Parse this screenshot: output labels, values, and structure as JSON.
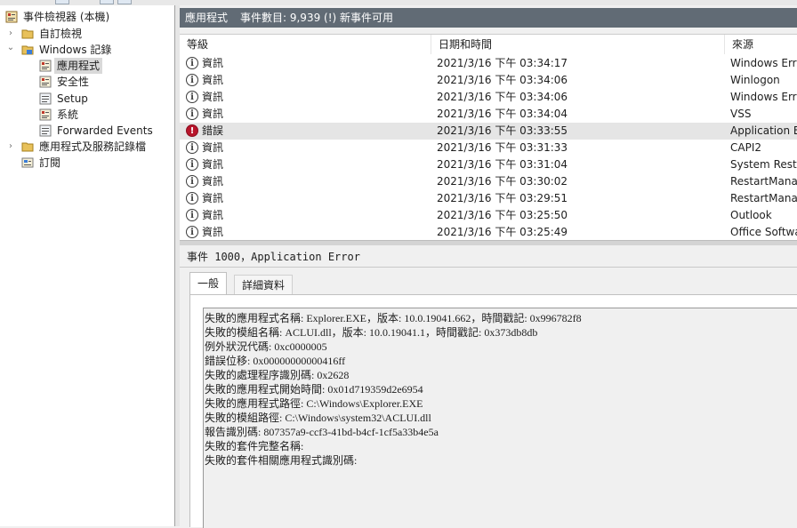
{
  "tree": {
    "items": [
      {
        "label": "事件檢視器 (本機)",
        "icon": "event-viewer-icon",
        "chevron": ""
      },
      {
        "label": "自訂檢視",
        "icon": "folder-icon",
        "chevron": "›"
      },
      {
        "label": "Windows 記錄",
        "icon": "folder-icon",
        "chevron": "⌄"
      },
      {
        "label": "應用程式",
        "icon": "log-icon",
        "chevron": ""
      },
      {
        "label": "安全性",
        "icon": "log-icon",
        "chevron": ""
      },
      {
        "label": "Setup",
        "icon": "log-icon",
        "chevron": ""
      },
      {
        "label": "系統",
        "icon": "log-icon",
        "chevron": ""
      },
      {
        "label": "Forwarded Events",
        "icon": "log-icon",
        "chevron": ""
      },
      {
        "label": "應用程式及服務記錄檔",
        "icon": "folder-icon",
        "chevron": "›"
      },
      {
        "label": "訂閱",
        "icon": "subscription-icon",
        "chevron": ""
      }
    ]
  },
  "header": {
    "log_name": "應用程式",
    "event_count": "事件數目: 9,939 (!) 新事件可用"
  },
  "list": {
    "columns": [
      "等級",
      "日期和時間",
      "來源"
    ],
    "rows": [
      {
        "level": "資訊",
        "type": "info",
        "datetime": "2021/3/16 下午 03:34:17",
        "source": "Windows Error Reporting"
      },
      {
        "level": "資訊",
        "type": "info",
        "datetime": "2021/3/16 下午 03:34:06",
        "source": "Winlogon"
      },
      {
        "level": "資訊",
        "type": "info",
        "datetime": "2021/3/16 下午 03:34:06",
        "source": "Windows Error Reporting"
      },
      {
        "level": "資訊",
        "type": "info",
        "datetime": "2021/3/16 下午 03:34:04",
        "source": "VSS"
      },
      {
        "level": "錯誤",
        "type": "error",
        "datetime": "2021/3/16 下午 03:33:55",
        "source": "Application Error"
      },
      {
        "level": "資訊",
        "type": "info",
        "datetime": "2021/3/16 下午 03:31:33",
        "source": "CAPI2"
      },
      {
        "level": "資訊",
        "type": "info",
        "datetime": "2021/3/16 下午 03:31:04",
        "source": "System Restore"
      },
      {
        "level": "資訊",
        "type": "info",
        "datetime": "2021/3/16 下午 03:30:02",
        "source": "RestartManager"
      },
      {
        "level": "資訊",
        "type": "info",
        "datetime": "2021/3/16 下午 03:29:51",
        "source": "RestartManager"
      },
      {
        "level": "資訊",
        "type": "info",
        "datetime": "2021/3/16 下午 03:25:50",
        "source": "Outlook"
      },
      {
        "level": "資訊",
        "type": "info",
        "datetime": "2021/3/16 下午 03:25:49",
        "source": "Office Software Protection"
      }
    ]
  },
  "detail": {
    "title": "事件 1000，Application Error",
    "tabs": [
      "一般",
      "詳細資料"
    ],
    "description": [
      "失敗的應用程式名稱: Explorer.EXE，版本: 10.0.19041.662，時間戳記: 0x996782f8",
      "失敗的模組名稱: ACLUI.dll，版本: 10.0.19041.1，時間戳記: 0x373db8db",
      "例外狀況代碼: 0xc0000005",
      "錯誤位移: 0x00000000000416ff",
      "失敗的處理程序識別碼: 0x2628",
      "失敗的應用程式開始時間: 0x01d719359d2e6954",
      "失敗的應用程式路徑: C:\\Windows\\Explorer.EXE",
      "失敗的模組路徑: C:\\Windows\\system32\\ACLUI.dll",
      "報告識別碼: 807357a9-ccf3-41bd-b4cf-1cf5a33b4e5a",
      "失敗的套件完整名稱:",
      "失敗的套件相關應用程式識別碼:"
    ]
  },
  "colors": {
    "header_bg": "#616b75",
    "error_icon": "#b8152b",
    "selection": "#e5e5e5"
  }
}
